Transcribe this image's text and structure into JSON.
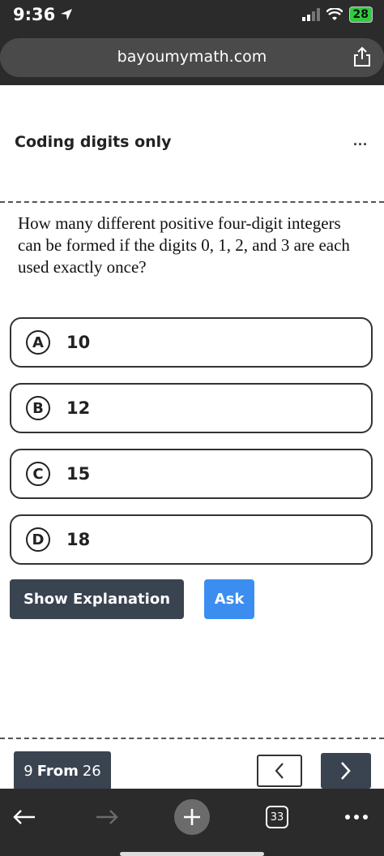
{
  "status_bar": {
    "time": "9:36",
    "battery": "28"
  },
  "browser": {
    "url": "bayoumymath.com"
  },
  "page": {
    "title": "Coding digits only",
    "more": "..."
  },
  "question": {
    "text": "How many different positive four-digit integers can be formed if the digits 0, 1, 2, and 3 are each used exactly once?"
  },
  "options": [
    {
      "letter": "A",
      "value": "10"
    },
    {
      "letter": "B",
      "value": "12"
    },
    {
      "letter": "C",
      "value": "15"
    },
    {
      "letter": "D",
      "value": "18"
    }
  ],
  "actions": {
    "show_explanation": "Show Explanation",
    "ask": "Ask"
  },
  "pagination": {
    "current": "9",
    "from_label": "From",
    "total": "26"
  },
  "bottom_nav": {
    "tabs_count": "33"
  },
  "colors": {
    "dark": "#3a4450",
    "accent": "#3b8ef0",
    "browser_chrome": "#2b2b2b"
  }
}
